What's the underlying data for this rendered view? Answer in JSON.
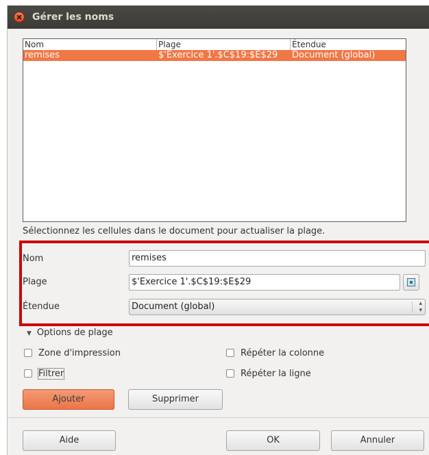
{
  "window": {
    "title": "Gérer les noms"
  },
  "table": {
    "headers": [
      "Nom",
      "Plage",
      "Étendue"
    ],
    "rows": [
      {
        "name": "remises",
        "range": "$'Exercice 1'.$C$19:$E$29",
        "scope": "Document (global)",
        "selected": true
      }
    ]
  },
  "hint": "Sélectionnez les cellules dans le document pour actualiser la plage.",
  "form": {
    "name_label": "Nom",
    "name_value": "remises",
    "range_label": "Plage",
    "range_value": "$'Exercice 1'.$C$19:$E$29",
    "scope_label": "Étendue",
    "scope_value": "Document (global)"
  },
  "options": {
    "title": "Options de plage",
    "print_range": "Zone d'impression",
    "filter": "Filtrer",
    "repeat_column": "Répéter la colonne",
    "repeat_row": "Répéter la ligne"
  },
  "buttons": {
    "add": "Ajouter",
    "delete": "Supprimer",
    "help": "Aide",
    "ok": "OK",
    "cancel": "Annuler"
  },
  "colors": {
    "accent": "#f07746",
    "highlight_border": "#cc0000",
    "titlebar": "#3c3b37"
  }
}
